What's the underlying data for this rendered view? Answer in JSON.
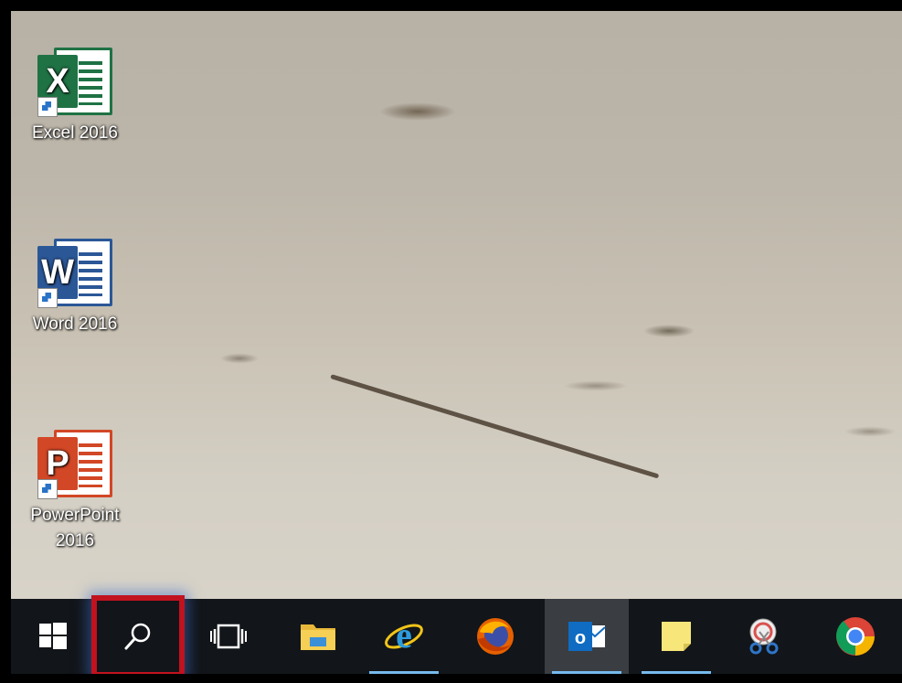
{
  "desktop": {
    "icons": [
      {
        "label": "Excel 2016",
        "badge": "X",
        "icon": "excel-icon"
      },
      {
        "label": "Word 2016",
        "badge": "W",
        "icon": "word-icon"
      },
      {
        "label_line1": "PowerPoint",
        "label_line2": "2016",
        "badge": "P",
        "icon": "powerpoint-icon"
      }
    ]
  },
  "taskbar": {
    "items": [
      "start-button",
      "search-button",
      "task-view-button",
      "file-explorer",
      "internet-explorer",
      "firefox",
      "outlook",
      "sticky-notes",
      "snipping-tool",
      "chrome"
    ],
    "highlight_color": "#c1121f",
    "active_item": "outlook"
  }
}
